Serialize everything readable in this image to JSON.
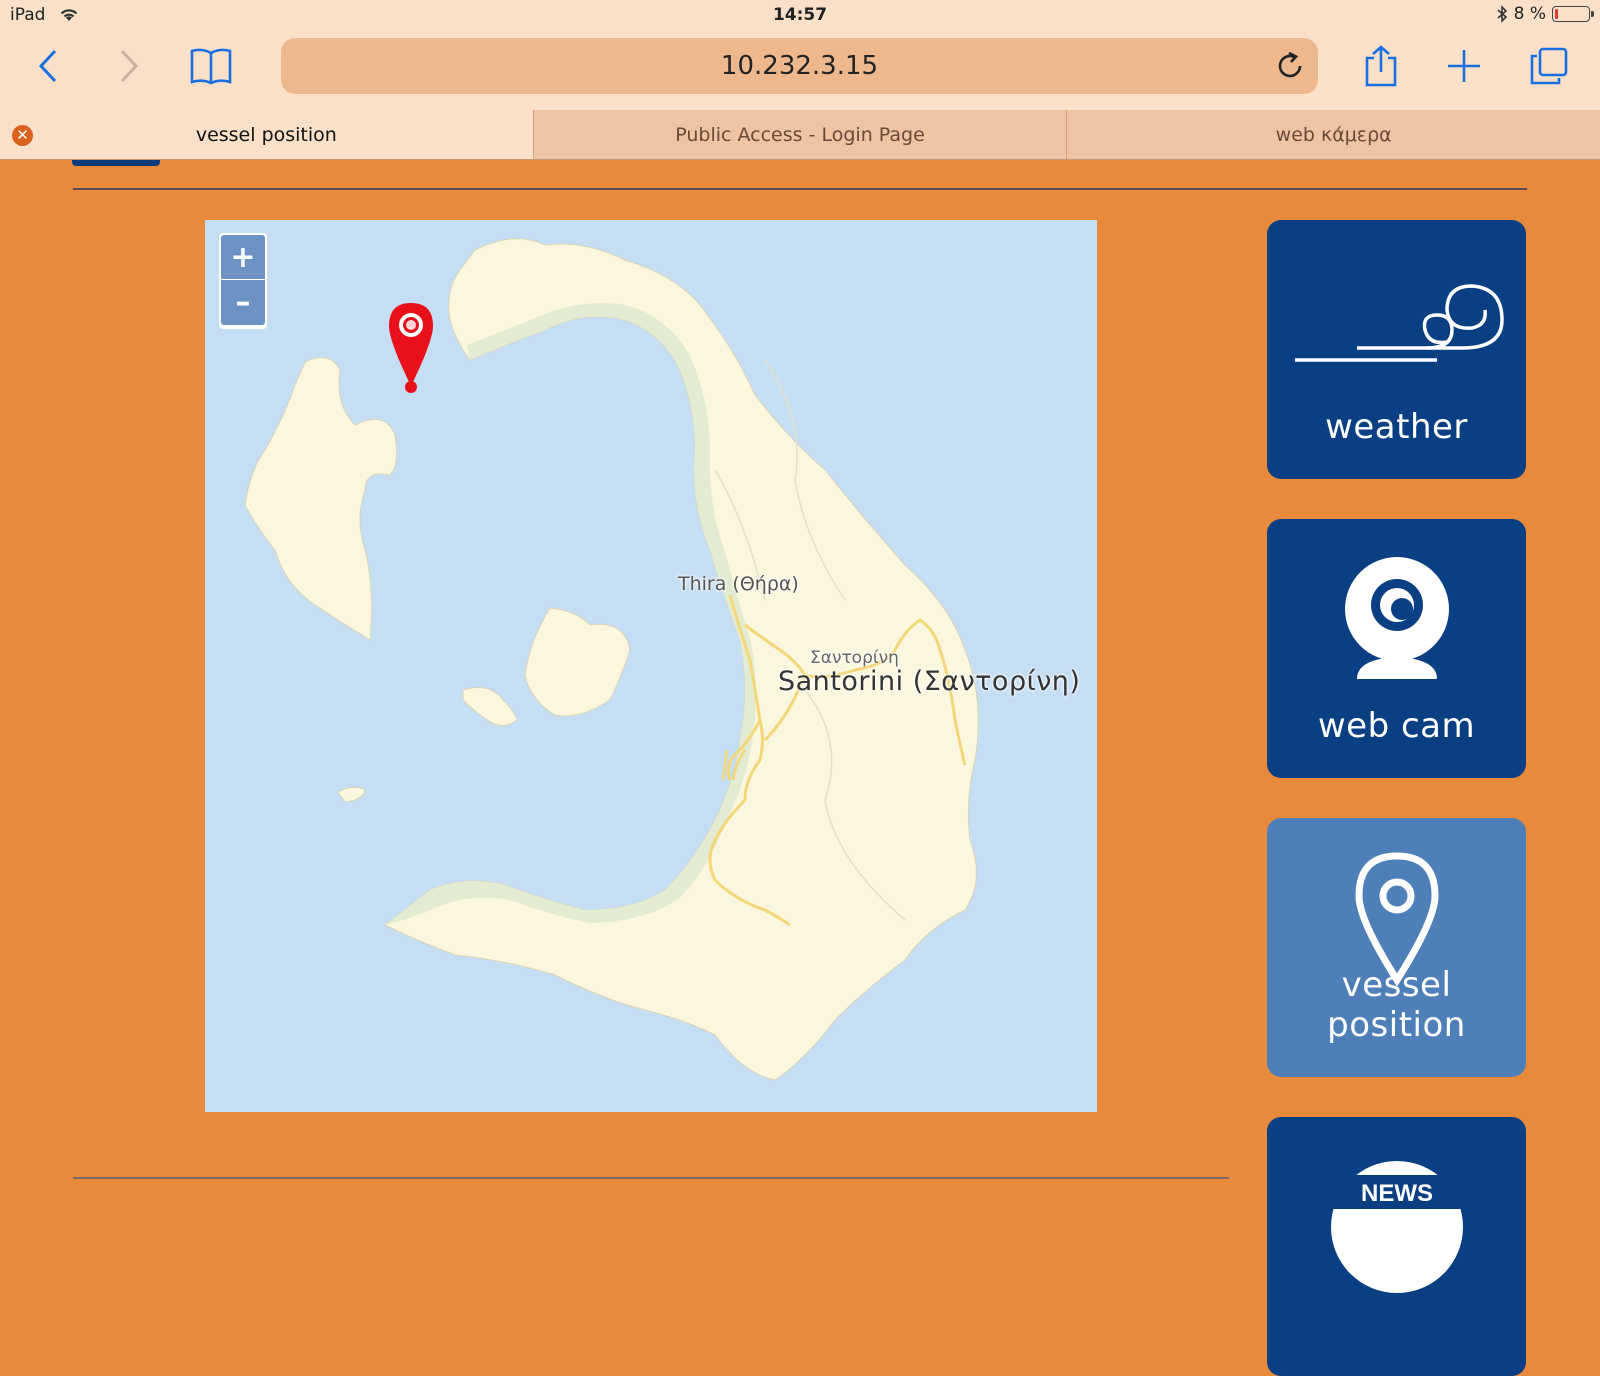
{
  "status_bar": {
    "device": "iPad",
    "time": "14:57",
    "battery": "8 %",
    "battery_level_pct": 8
  },
  "browser": {
    "url": "10.232.3.15",
    "tabs": [
      {
        "label": "vessel position",
        "active": true
      },
      {
        "label": "Public Access - Login Page",
        "active": false
      },
      {
        "label": "web κάμερα",
        "active": false
      }
    ]
  },
  "map": {
    "zoom_in": "+",
    "zoom_out": "–",
    "labels": {
      "town": "Thira (Θήρα)",
      "island_greek": "Σαντορίνη",
      "island": "Santorini (Σαντορίνη)"
    },
    "colors": {
      "sea": "#c6def3",
      "land": "#fbf7df",
      "coast": "#e3ebd2",
      "road": "#f3d778",
      "marker": "#e8101a"
    }
  },
  "sidebar": {
    "tiles": [
      {
        "label": "weather",
        "icon": "wind-icon",
        "active": false
      },
      {
        "label": "web cam",
        "icon": "webcam-icon",
        "active": false
      },
      {
        "label": "vessel position",
        "icon": "location-pin-icon",
        "active": true
      },
      {
        "label": "NEWS",
        "icon": "news-icon",
        "active": false
      }
    ],
    "colors": {
      "tile": "#0a3f83",
      "tile_active": "#4e7fb8"
    }
  }
}
